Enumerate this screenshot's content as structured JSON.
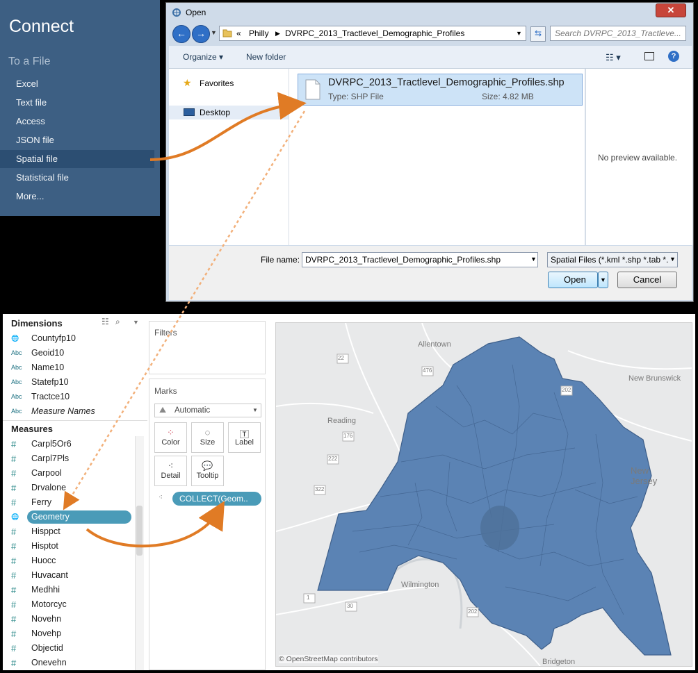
{
  "connect": {
    "title": "Connect",
    "subtitle": "To a File",
    "items": [
      "Excel",
      "Text file",
      "Access",
      "JSON file",
      "Spatial file",
      "Statistical file",
      "More..."
    ],
    "selected_index": 4
  },
  "dialog": {
    "title": "Open",
    "breadcrumb": [
      "«",
      "Philly",
      "DVRPC_2013_Tractlevel_Demographic_Profiles"
    ],
    "search_placeholder": "Search DVRPC_2013_Tractleve...",
    "organize_label": "Organize ▾",
    "new_folder_label": "New folder",
    "nav": [
      "Favorites",
      "Desktop"
    ],
    "file": {
      "name": "DVRPC_2013_Tractlevel_Demographic_Profiles.shp",
      "type_label": "Type: SHP File",
      "size_label": "Size: 4.82 MB"
    },
    "preview_text": "No preview available.",
    "filename_label": "File name:",
    "filename_value": "DVRPC_2013_Tractlevel_Demographic_Profiles.shp",
    "filetype_value": "Spatial Files (*.kml *.shp *.tab *.",
    "open_label": "Open",
    "cancel_label": "Cancel"
  },
  "tableau": {
    "dimensions_title": "Dimensions",
    "dimensions": [
      {
        "icon": "globe",
        "name": "Countyfp10"
      },
      {
        "icon": "Abc",
        "name": "Geoid10"
      },
      {
        "icon": "Abc",
        "name": "Name10"
      },
      {
        "icon": "Abc",
        "name": "Statefp10"
      },
      {
        "icon": "Abc",
        "name": "Tractce10"
      },
      {
        "icon": "Abc",
        "name": "Measure Names"
      }
    ],
    "measures_title": "Measures",
    "measures": [
      {
        "icon": "#",
        "name": "Carpl5Or6"
      },
      {
        "icon": "#",
        "name": "Carpl7Pls"
      },
      {
        "icon": "#",
        "name": "Carpool"
      },
      {
        "icon": "#",
        "name": "Drvalone"
      },
      {
        "icon": "#",
        "name": "Ferry"
      },
      {
        "icon": "globe",
        "name": "Geometry"
      },
      {
        "icon": "#",
        "name": "Hisppct"
      },
      {
        "icon": "#",
        "name": "Hisptot"
      },
      {
        "icon": "#",
        "name": "Huocc"
      },
      {
        "icon": "#",
        "name": "Huvacant"
      },
      {
        "icon": "#",
        "name": "Medhhi"
      },
      {
        "icon": "#",
        "name": "Motorcyc"
      },
      {
        "icon": "#",
        "name": "Novehn"
      },
      {
        "icon": "#",
        "name": "Novehp"
      },
      {
        "icon": "#",
        "name": "Objectid"
      },
      {
        "icon": "#",
        "name": "Onevehn"
      }
    ],
    "selected_measure": "Geometry",
    "filters_title": "Filters",
    "marks_title": "Marks",
    "mark_type": "Automatic",
    "mark_buttons": [
      "Color",
      "Size",
      "Label",
      "Detail",
      "Tooltip"
    ],
    "mark_pill": "COLLECT(Geom..",
    "map": {
      "labels": [
        "Allentown",
        "New Brunswick",
        "Reading",
        "New Jersey",
        "Wilmington",
        "Bridgeton"
      ],
      "route_shields": [
        "22",
        "476",
        "202",
        "176",
        "222",
        "322",
        "1",
        "202",
        "30"
      ],
      "attribution": "© OpenStreetMap contributors",
      "region_color": "#5b83b4"
    }
  }
}
